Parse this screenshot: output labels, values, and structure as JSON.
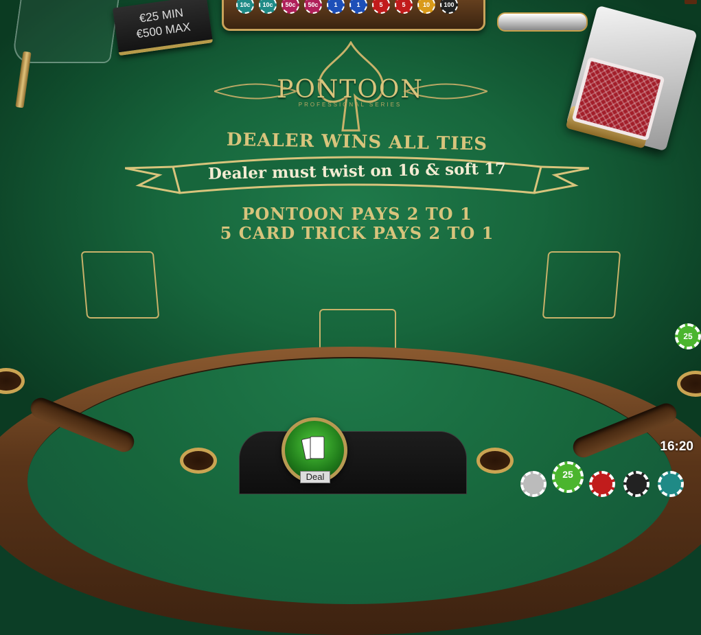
{
  "table": {
    "limits": {
      "min": "€25 MIN",
      "max": "€500 MAX"
    },
    "logo": {
      "title": "PONTOON",
      "subtitle": "PROFESSIONAL SERIES"
    },
    "rules": {
      "line1": "DEALER WINS ALL TIES",
      "line2": "Dealer must twist on 16 & soft 17",
      "line3": "PONTOON PAYS 2 TO 1",
      "line4": "5 CARD TRICK PAYS 2 TO 1"
    },
    "tray_chips": [
      {
        "label": "10c",
        "color": "#1f8a86"
      },
      {
        "label": "10c",
        "color": "#1f8a86"
      },
      {
        "label": "50c",
        "color": "#b0205a"
      },
      {
        "label": "50c",
        "color": "#b0205a"
      },
      {
        "label": "1",
        "color": "#1d4fb8"
      },
      {
        "label": "1",
        "color": "#1d4fb8"
      },
      {
        "label": "5",
        "color": "#c11c1c"
      },
      {
        "label": "5",
        "color": "#c11c1c"
      },
      {
        "label": "10",
        "color": "#d99a1a"
      },
      {
        "label": "100",
        "color": "#222222"
      }
    ],
    "selected_chip": "25",
    "side_chip": "25"
  },
  "controls": {
    "deal_label": "Deal"
  },
  "status": {
    "clock": "16:20"
  },
  "colors": {
    "felt": "#17663c",
    "gold": "#d8c47c",
    "rail": "#5a3519"
  }
}
